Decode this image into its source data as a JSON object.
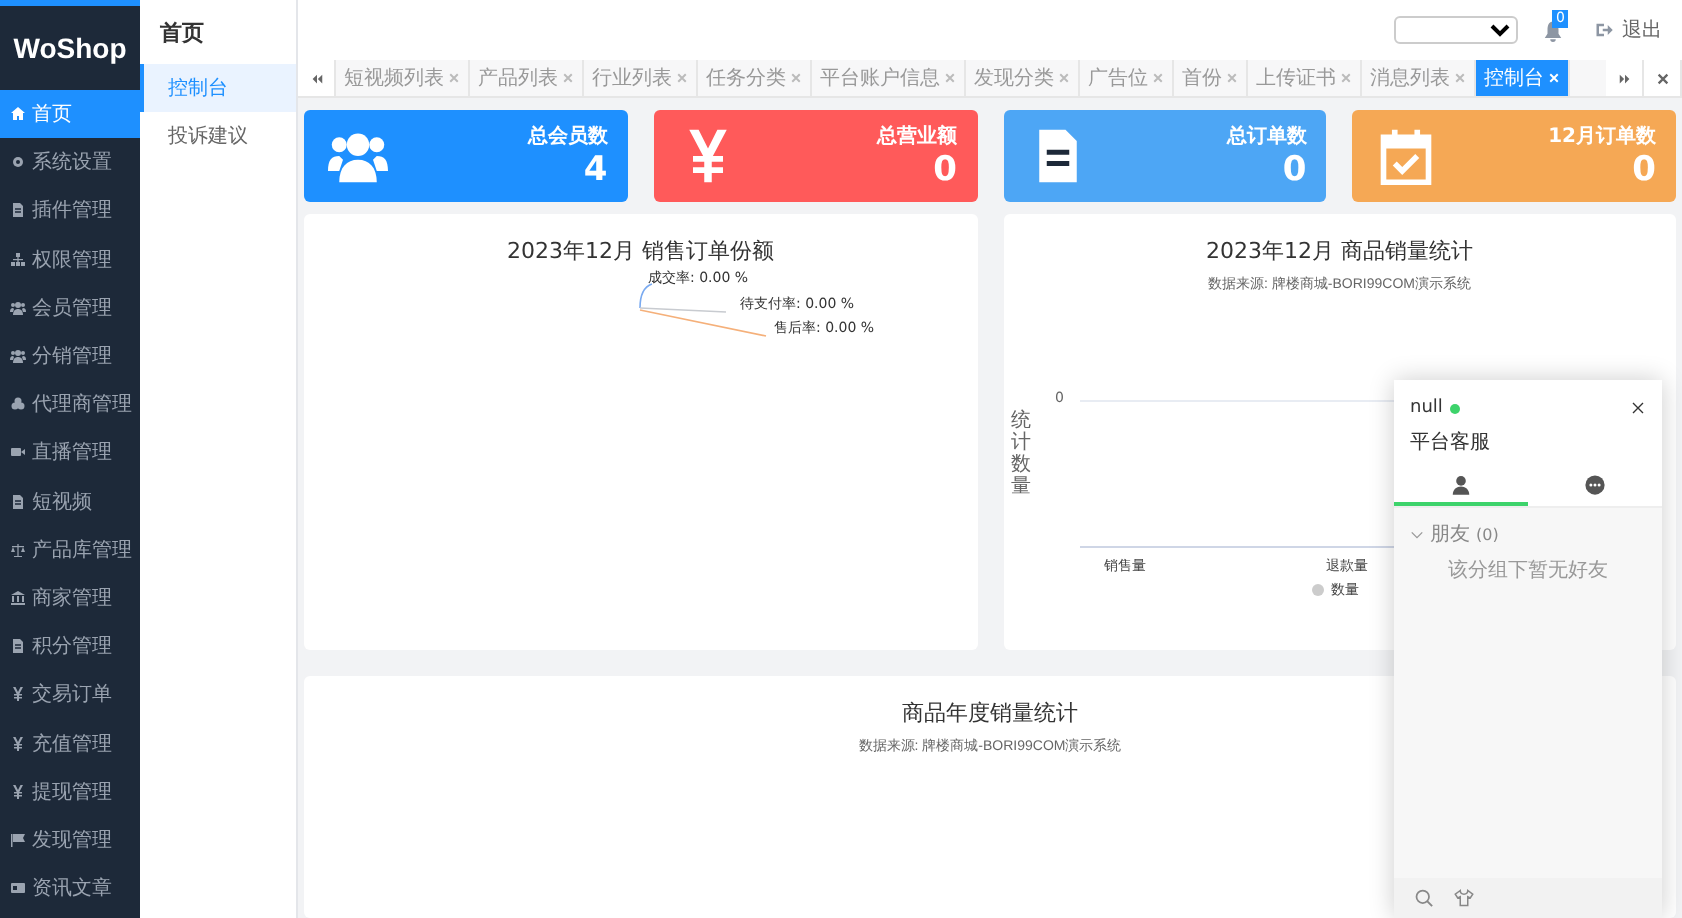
{
  "sidebar": {
    "logo": "WoShop",
    "items": [
      {
        "label": "首页",
        "kind": "home",
        "selected": true
      },
      {
        "label": "系统设置",
        "kind": "gear",
        "selected": false
      },
      {
        "label": "插件管理",
        "kind": "doc",
        "selected": false
      },
      {
        "label": "权限管理",
        "kind": "sitemap",
        "selected": false
      },
      {
        "label": "会员管理",
        "kind": "users",
        "selected": false
      },
      {
        "label": "分销管理",
        "kind": "users",
        "selected": false
      },
      {
        "label": "代理商管理",
        "kind": "cubes",
        "selected": false
      },
      {
        "label": "直播管理",
        "kind": "video",
        "selected": false
      },
      {
        "label": "短视频",
        "kind": "doc",
        "selected": false
      },
      {
        "label": "产品库管理",
        "kind": "scale",
        "selected": false
      },
      {
        "label": "商家管理",
        "kind": "bank",
        "selected": false
      },
      {
        "label": "积分管理",
        "kind": "doc",
        "selected": false
      },
      {
        "label": "交易订单",
        "kind": "yen",
        "selected": false
      },
      {
        "label": "充值管理",
        "kind": "yen",
        "selected": false
      },
      {
        "label": "提现管理",
        "kind": "yen",
        "selected": false
      },
      {
        "label": "发现管理",
        "kind": "flag",
        "selected": false
      },
      {
        "label": "资讯文章",
        "kind": "card",
        "selected": false
      }
    ]
  },
  "subnav": {
    "title": "首页",
    "items": [
      {
        "label": "控制台",
        "selected": true
      },
      {
        "label": "投诉建议",
        "selected": false
      }
    ]
  },
  "topbar": {
    "notification_count": "0",
    "logout": "退出"
  },
  "tabs": [
    {
      "label": "短视频列表",
      "selected": false
    },
    {
      "label": "产品列表",
      "selected": false
    },
    {
      "label": "行业列表",
      "selected": false
    },
    {
      "label": "任务分类",
      "selected": false
    },
    {
      "label": "平台账户信息",
      "selected": false
    },
    {
      "label": "发现分类",
      "selected": false
    },
    {
      "label": "广告位",
      "selected": false
    },
    {
      "label": "首份",
      "selected": false
    },
    {
      "label": "上传证书",
      "selected": false
    },
    {
      "label": "消息列表",
      "selected": false
    },
    {
      "label": "控制台",
      "selected": true
    }
  ],
  "stats": [
    {
      "label": "总会员数",
      "value": "4",
      "kind": "users",
      "color": "#1e90ff"
    },
    {
      "label": "总营业额",
      "value": "0",
      "kind": "yen",
      "color": "#ff5a5a"
    },
    {
      "label": "总订单数",
      "value": "0",
      "kind": "doc",
      "color": "#4da6f5"
    },
    {
      "label": "12月订单数",
      "value": "0",
      "kind": "calendar",
      "color": "#f5a855"
    }
  ],
  "pie_panel": {
    "title": "2023年12月 销售订单份额",
    "labels": [
      "成交率: 0.00 %",
      "待支付率: 0.00 %",
      "售后率: 0.00 %"
    ]
  },
  "bar_panel": {
    "title": "2023年12月 商品销量统计",
    "subtitle": "数据来源: 牌楼商城-BORI99COM演示系统",
    "ylabel": "统计数量",
    "ytick": "0",
    "categories": [
      "销售量",
      "退款量"
    ],
    "legend": "数量"
  },
  "year_panel": {
    "title": "商品年度销量统计",
    "subtitle": "数据来源: 牌楼商城-BORI99COM演示系统"
  },
  "chat": {
    "name": "null",
    "online": true,
    "subtitle": "平台客服",
    "tabs": [
      {
        "kind": "person",
        "selected": true
      },
      {
        "kind": "chat",
        "selected": false
      }
    ],
    "groups": [
      {
        "label": "朋友",
        "count": "(0)",
        "expanded": true,
        "empty_text": "该分组下暂无好友"
      }
    ]
  }
}
